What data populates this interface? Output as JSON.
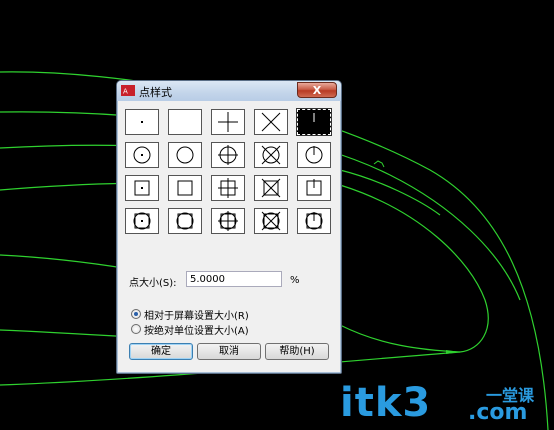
{
  "dialog": {
    "title": "点样式",
    "close_label": "X",
    "point_size_label": "点大小(S):",
    "point_size_value": "5.0000",
    "percent": "%",
    "radio_relative": "相对于屏幕设置大小(R)",
    "radio_absolute": "按绝对单位设置大小(A)",
    "ok": "确定",
    "cancel": "取消",
    "help": "帮助(H)"
  },
  "styles": {
    "rows": [
      [
        "dot-point-style",
        "blank-point-style",
        "plus-point-style",
        "x-point-style",
        "tick-point-style"
      ],
      [
        "circle-dot-point-style",
        "circle-point-style",
        "circle-plus-point-style",
        "circle-x-point-style",
        "circle-tick-point-style"
      ],
      [
        "square-dot-point-style",
        "square-point-style",
        "square-plus-point-style",
        "square-x-point-style",
        "square-tick-point-style"
      ],
      [
        "circle-square-dot-point-style",
        "circle-square-point-style",
        "circle-square-plus-point-style",
        "circle-square-x-point-style",
        "circle-square-tick-point-style"
      ]
    ],
    "selected": "tick-point-style"
  },
  "colors": {
    "drawing_lines": "#2fd12f",
    "watermark": "#2a9be0",
    "background": "#000000"
  },
  "watermark": {
    "main": "itk3",
    "sub": "一堂课",
    "domain": ".com"
  }
}
